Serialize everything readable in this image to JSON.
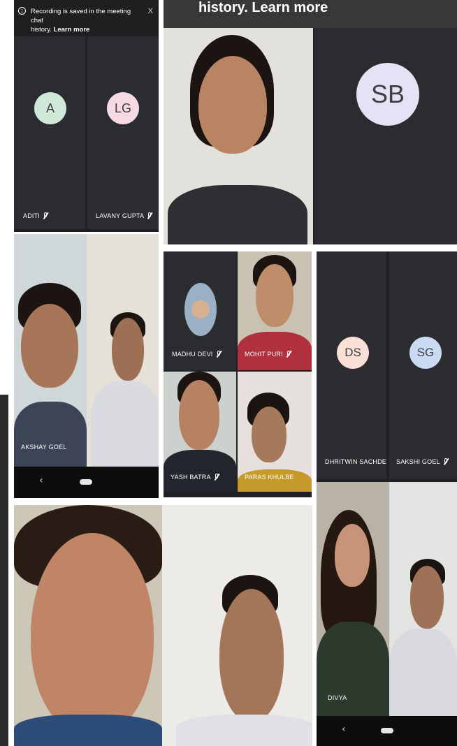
{
  "screenshot_1": {
    "banner": {
      "text": "Recording is saved in the meeting chat",
      "text2": "history.",
      "link": "Learn more",
      "close": "X"
    },
    "participants": [
      {
        "initials": "A",
        "name": "ADITI"
      },
      {
        "initials": "LG",
        "name": "LAVANY GUPTA"
      }
    ]
  },
  "screenshot_2": {
    "banner_text": "history.",
    "banner_link": "Learn more",
    "participant": {
      "initials": "SB"
    }
  },
  "screenshot_3": {
    "participant": {
      "name": "AKSHAY GOEL"
    },
    "nav": {
      "back": "‹"
    }
  },
  "screenshot_4": {
    "participants": [
      {
        "name": "MADHU DEVI"
      },
      {
        "name": "MOHIT PURI"
      },
      {
        "name": "YASH BATRA"
      },
      {
        "name": "PARAS KHULBE"
      }
    ]
  },
  "screenshot_5": {
    "participants": [
      {
        "initials": "DS",
        "name": "DHRITWIN SACHDE.."
      },
      {
        "initials": "SG",
        "name": "SAKSHI GOEL"
      }
    ]
  },
  "screenshot_7": {
    "participant": {
      "name": "DIVYA"
    },
    "nav": {
      "back": "‹"
    }
  },
  "colors": {
    "tile_bg": "#2b2c2f",
    "avatar_green": "#cfe8d8",
    "avatar_pink": "#f6d9e4",
    "avatar_lavender": "#e4e2f4",
    "avatar_peach": "#f9dfd6",
    "avatar_blue": "#c9daf2"
  }
}
